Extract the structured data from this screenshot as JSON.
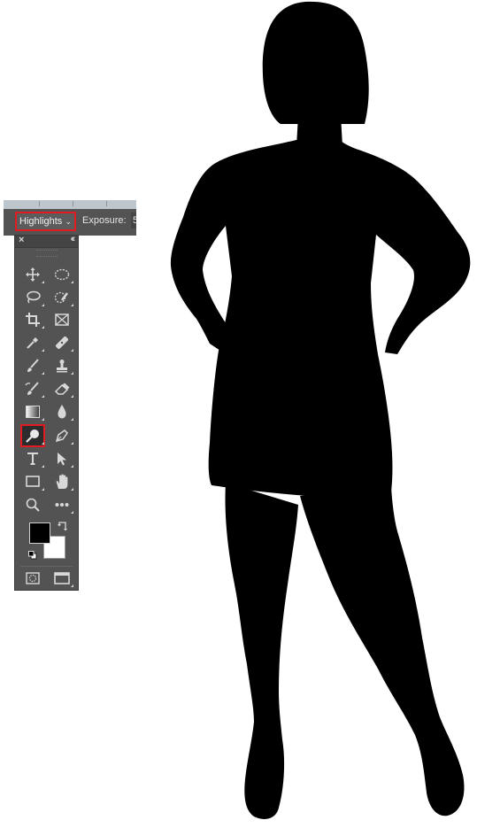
{
  "options_bar": {
    "range_mode": "Highlights",
    "exposure_label": "Exposure:",
    "exposure_value": "5"
  },
  "tools_panel": {
    "close_glyph": "×",
    "collapse_glyph": "‹‹",
    "selected_tool": "dodge-tool",
    "tools": [
      "move-icon",
      "elliptical-marquee-icon",
      "lasso-icon",
      "quick-selection-icon",
      "crop-icon",
      "frame-icon",
      "eyedropper-icon",
      "healing-brush-icon",
      "brush-icon",
      "clone-stamp-icon",
      "history-brush-icon",
      "eraser-icon",
      "gradient-icon",
      "blur-icon",
      "dodge-icon",
      "pen-icon",
      "type-icon",
      "path-selection-icon",
      "rectangle-icon",
      "hand-icon",
      "zoom-icon",
      "more-icon"
    ],
    "foreground_color": "#000000",
    "background_color": "#ffffff"
  },
  "colors": {
    "highlight_red": "#e01b22",
    "panel_bg": "#535353",
    "silhouette": "#000000"
  }
}
